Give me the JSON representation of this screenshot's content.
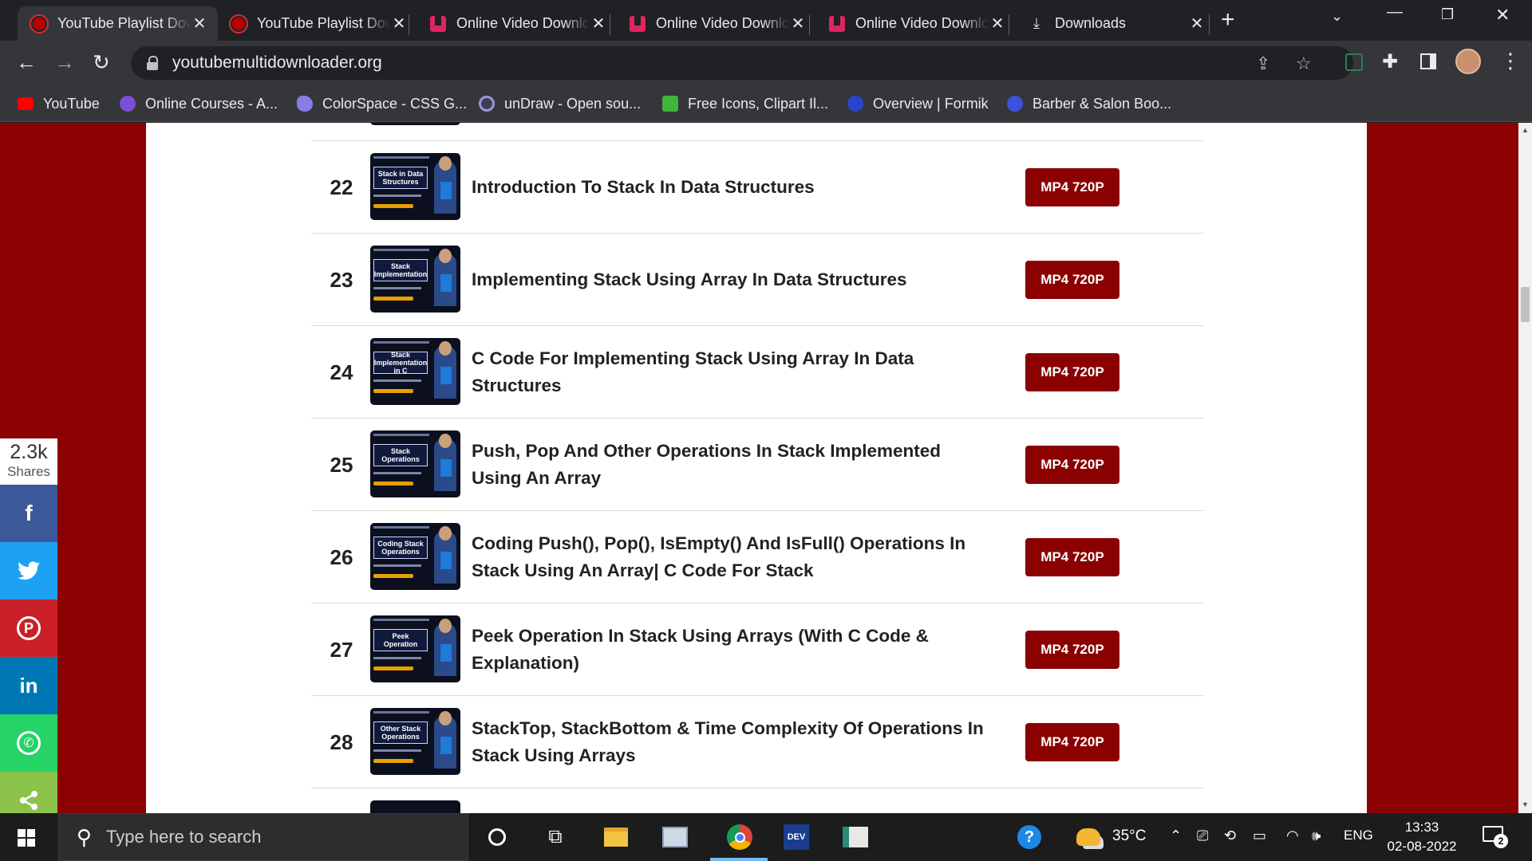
{
  "browser": {
    "tabs": [
      {
        "title": "YouTube Playlist Downloader",
        "favicon": "youtube-downloader-icon",
        "active": true
      },
      {
        "title": "YouTube Playlist Downloader",
        "favicon": "youtube-downloader-icon",
        "active": false
      },
      {
        "title": "Online Video Downloader",
        "favicon": "video-downloader-icon",
        "active": false
      },
      {
        "title": "Online Video Downloader",
        "favicon": "video-downloader-icon",
        "active": false
      },
      {
        "title": "Online Video Downloader",
        "favicon": "video-downloader-icon",
        "active": false
      },
      {
        "title": "Downloads",
        "favicon": "download-icon",
        "active": false
      }
    ],
    "url": "youtubemultidownloader.org",
    "bookmarks": [
      {
        "label": "YouTube",
        "color": "#ff0000"
      },
      {
        "label": "Online Courses - A...",
        "color": "#7b4fd6"
      },
      {
        "label": "ColorSpace - CSS G...",
        "color": "#8a7ce6"
      },
      {
        "label": "unDraw - Open sou...",
        "color": "#3f3d56"
      },
      {
        "label": "Free Icons, Clipart Il...",
        "color": "#41b341"
      },
      {
        "label": "Overview | Formik",
        "color": "#2a44c9"
      },
      {
        "label": "Barber & Salon Boo...",
        "color": "#3c52d9"
      }
    ]
  },
  "share": {
    "count": "2.3k",
    "label": "Shares",
    "buttons": [
      {
        "name": "facebook",
        "glyph": "f",
        "color": "#3b5998"
      },
      {
        "name": "twitter",
        "glyph": "🐦",
        "color": "#1da1f2"
      },
      {
        "name": "pinterest",
        "glyph": "P",
        "color": "#cb2027"
      },
      {
        "name": "linkedin",
        "glyph": "in",
        "color": "#0077b5"
      },
      {
        "name": "whatsapp",
        "glyph": "✆",
        "color": "#25d366"
      },
      {
        "name": "share",
        "glyph": "⋖",
        "color": "#8bc34a"
      }
    ]
  },
  "videos": [
    {
      "num": "22",
      "title": "Introduction To Stack In Data Structures",
      "thumb": "Stack in Data Structures",
      "button": "MP4 720P"
    },
    {
      "num": "23",
      "title": "Implementing Stack Using Array In Data Structures",
      "thumb": "Stack Implementation",
      "button": "MP4 720P"
    },
    {
      "num": "24",
      "title": "C Code For Implementing Stack Using Array In Data Structures",
      "thumb": "Stack Implementation in C",
      "button": "MP4 720P"
    },
    {
      "num": "25",
      "title": "Push, Pop And Other Operations In Stack Implemented Using An Array",
      "thumb": "Stack Operations",
      "button": "MP4 720P"
    },
    {
      "num": "26",
      "title": "Coding Push(), Pop(), IsEmpty() And IsFull() Operations In Stack Using An Array| C Code For Stack",
      "thumb": "Coding Stack Operations",
      "button": "MP4 720P"
    },
    {
      "num": "27",
      "title": "Peek Operation In Stack Using Arrays (With C Code & Explanation)",
      "thumb": "Peek Operation",
      "button": "MP4 720P"
    },
    {
      "num": "28",
      "title": "StackTop, StackBottom & Time Complexity Of Operations In Stack Using Arrays",
      "thumb": "Other Stack Operations",
      "button": "MP4 720P"
    }
  ],
  "taskbar": {
    "search_placeholder": "Type here to search",
    "weather": "35°C",
    "language": "ENG",
    "time": "13:33",
    "date": "02-08-2022",
    "notifications": "2"
  }
}
